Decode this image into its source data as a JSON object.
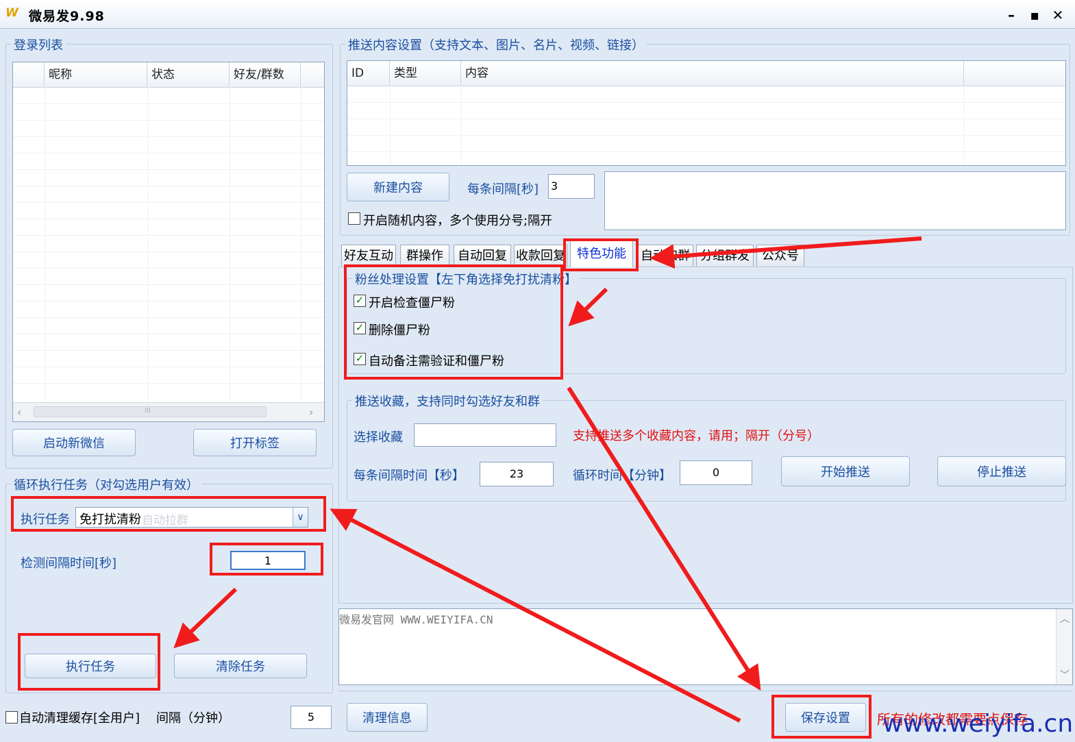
{
  "window": {
    "title": "微易发9.98",
    "logo": "W",
    "controls": [
      "minimize-icon",
      "maximize-icon",
      "close-icon"
    ]
  },
  "login_list": {
    "legend": "登录列表",
    "columns": [
      "",
      "昵称",
      "状态",
      "好友/群数"
    ],
    "scroll_mark": "III",
    "start_wechat": "启动新微信",
    "open_tag": "打开标签"
  },
  "push_content": {
    "legend": "推送内容设置（支持文本、图片、名片、视频、链接）",
    "columns": [
      "ID",
      "类型",
      "内容",
      ""
    ],
    "new_content": "新建内容",
    "interval_label": "每条间隔[秒]",
    "interval_value": "3",
    "random_label": "开启随机内容，多个使用分号;隔开"
  },
  "tabs": [
    {
      "label": "好友互动"
    },
    {
      "label": "群操作"
    },
    {
      "label": "自动回复"
    },
    {
      "label": "收款回复"
    },
    {
      "label": "特色功能",
      "active": true
    },
    {
      "label": "自动加群"
    },
    {
      "label": "分组群发"
    },
    {
      "label": "公众号"
    }
  ],
  "fans": {
    "legend": "粉丝处理设置【左下角选择免打扰清粉】",
    "options": [
      {
        "label": "开启检查僵尸粉",
        "checked": true
      },
      {
        "label": "删除僵尸粉",
        "checked": true
      },
      {
        "label": "自动备注需验证和僵尸粉",
        "checked": true
      }
    ]
  },
  "favorites": {
    "legend": "推送收藏，支持同时勾选好友和群",
    "select_label": "选择收藏",
    "select_value": "",
    "hint": "支持推送多个收藏内容，请用；隔开（分号）",
    "interval_label": "每条间隔时间【秒】",
    "interval_value": "23",
    "loop_label": "循环时间【分钟】",
    "loop_value": "0",
    "start": "开始推送",
    "stop": "停止推送"
  },
  "loop_task": {
    "legend": "循环执行任务（对勾选用户有效）",
    "task_label": "执行任务",
    "task_value": "免打扰清粉",
    "task_ghost": "自动拉群",
    "detect_label": "检测间隔时间[秒]",
    "detect_value": "1",
    "run": "执行任务",
    "clear": "清除任务"
  },
  "log": {
    "text": "微易发官网 WWW.WEIYIFA.CN"
  },
  "footer": {
    "auto_clean": "自动清理缓存[全用户]",
    "interval_label": "间隔（分钟）",
    "interval_value": "5",
    "clear_info": "清理信息",
    "save": "保存设置",
    "save_hint": "所有的修改都需要点保存",
    "watermark": "www.weiyifa.cn"
  },
  "colors": {
    "annotation": "#f01c1c",
    "label": "#1a4fa0",
    "active_tab": "#0a2fd0"
  }
}
